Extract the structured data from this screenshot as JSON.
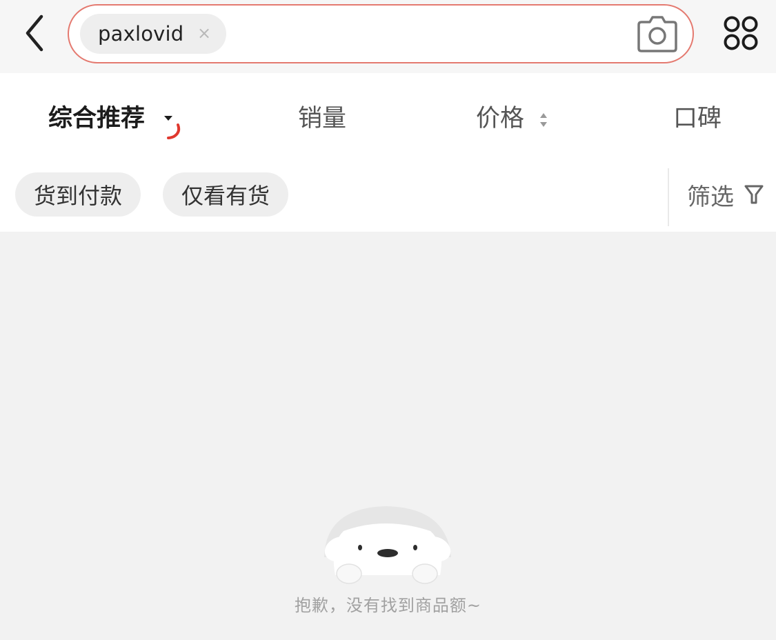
{
  "header": {
    "back_icon": "chevron-left-icon",
    "search": {
      "tag_label": "paxlovid",
      "tag_close": "×",
      "camera_icon": "camera-icon",
      "border_color": "#e4796f"
    },
    "menu_icon": "grid-four-circles-icon"
  },
  "sort": {
    "items": [
      {
        "label": "综合推荐",
        "active": true
      },
      {
        "label": "销量"
      },
      {
        "label": "价格"
      },
      {
        "label": "口碑"
      }
    ]
  },
  "filters": {
    "chips": [
      "货到付款",
      "仅看有货"
    ],
    "filter_label": "筛选",
    "filter_icon": "funnel-icon"
  },
  "empty": {
    "illustration": "puppy-illustration",
    "message": "抱歉，没有找到商品额~"
  },
  "colors": {
    "accent": "#e0382e",
    "background": "#f2f2f2"
  }
}
